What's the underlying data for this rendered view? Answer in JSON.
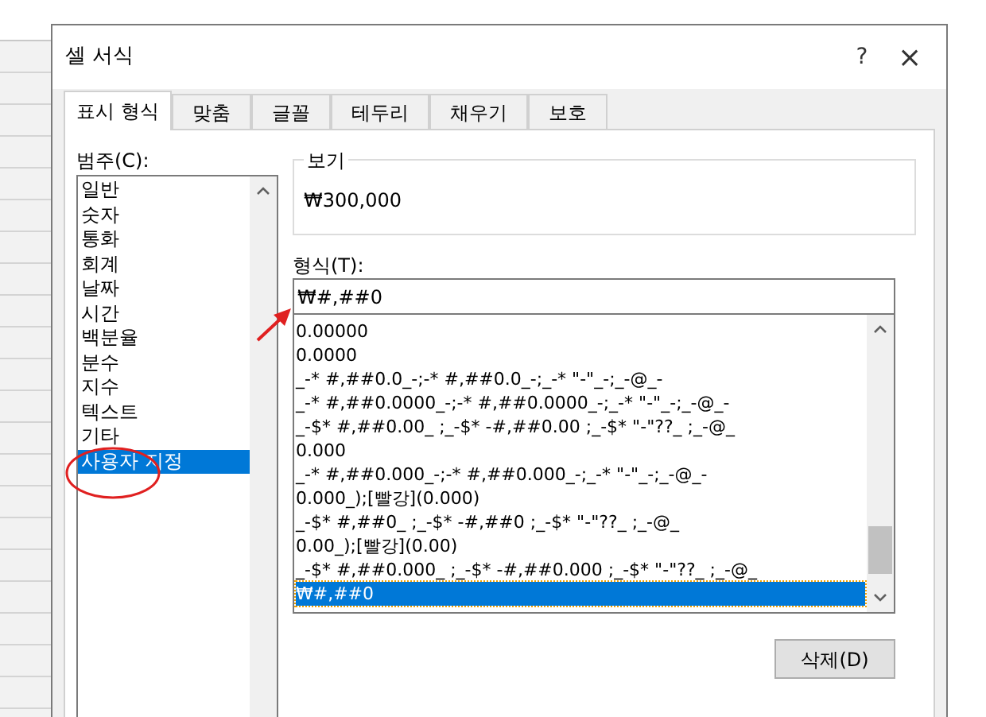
{
  "dialog": {
    "title": "셀 서식",
    "help": "?",
    "close": "×"
  },
  "tabs": [
    {
      "label": "표시 형식",
      "selected": true
    },
    {
      "label": "맞춤",
      "selected": false
    },
    {
      "label": "글꼴",
      "selected": false
    },
    {
      "label": "테두리",
      "selected": false
    },
    {
      "label": "채우기",
      "selected": false
    },
    {
      "label": "보호",
      "selected": false
    }
  ],
  "category": {
    "label": "범주(C):",
    "items": [
      {
        "label": "일반",
        "selected": false
      },
      {
        "label": "숫자",
        "selected": false
      },
      {
        "label": "통화",
        "selected": false
      },
      {
        "label": "회계",
        "selected": false
      },
      {
        "label": "날짜",
        "selected": false
      },
      {
        "label": "시간",
        "selected": false
      },
      {
        "label": "백분율",
        "selected": false
      },
      {
        "label": "분수",
        "selected": false
      },
      {
        "label": "지수",
        "selected": false
      },
      {
        "label": "텍스트",
        "selected": false
      },
      {
        "label": "기타",
        "selected": false
      },
      {
        "label": "사용자 지정",
        "selected": true
      }
    ]
  },
  "preview": {
    "label": "보기",
    "value": "₩300,000"
  },
  "format": {
    "label": "형식(T):",
    "value": "₩#,##0",
    "items": [
      {
        "label": "0.00000",
        "selected": false
      },
      {
        "label": "0.0000",
        "selected": false
      },
      {
        "label": "_-* #,##0.0_-;-* #,##0.0_-;_-* \"-\"_-;_-@_-",
        "selected": false
      },
      {
        "label": "_-* #,##0.0000_-;-* #,##0.0000_-;_-* \"-\"_-;_-@_-",
        "selected": false
      },
      {
        "label": "_-$* #,##0.00_ ;_-$* -#,##0.00 ;_-$* \"-\"??_ ;_-@_",
        "selected": false
      },
      {
        "label": "0.000",
        "selected": false
      },
      {
        "label": "_-* #,##0.000_-;-* #,##0.000_-;_-* \"-\"_-;_-@_-",
        "selected": false
      },
      {
        "label": "0.000_);[빨강](0.000)",
        "selected": false
      },
      {
        "label": "_-$* #,##0_ ;_-$* -#,##0 ;_-$* \"-\"??_ ;_-@_",
        "selected": false
      },
      {
        "label": "0.00_);[빨강](0.00)",
        "selected": false
      },
      {
        "label": "_-$* #,##0.000_ ;_-$* -#,##0.000 ;_-$* \"-\"??_ ;_-@_",
        "selected": false
      },
      {
        "label": "₩#,##0",
        "selected": true
      }
    ]
  },
  "delete_button": "삭제(D)"
}
